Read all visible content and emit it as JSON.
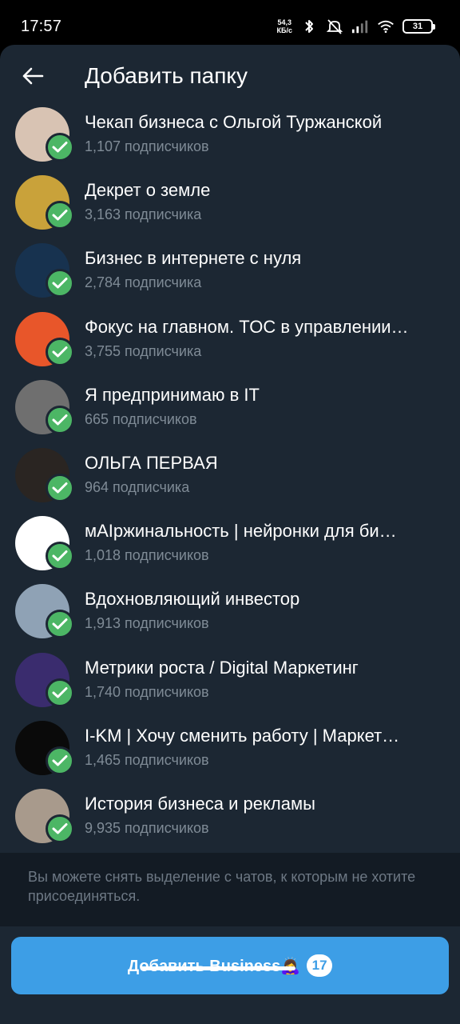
{
  "status_bar": {
    "time": "17:57",
    "net_speed_value": "54,3",
    "net_speed_unit": "КБ/с",
    "battery": "31",
    "icons": [
      "bluetooth-icon",
      "mute-icon",
      "signal-icon",
      "wifi-icon",
      "battery-icon"
    ]
  },
  "header": {
    "title": "Добавить папку",
    "back_icon": "arrow-left-icon"
  },
  "channels": [
    {
      "name": "Чекап бизнеса с Ольгой Туржанской",
      "subscribers": "1,107 подписчиков",
      "avatar_color": "#d8c3b3",
      "selected": true
    },
    {
      "name": "Декрет о земле",
      "subscribers": "3,163 подписчика",
      "avatar_color": "#c9a23a",
      "selected": true
    },
    {
      "name": "Бизнес в интернете с нуля",
      "subscribers": "2,784 подписчика",
      "avatar_color": "#17324f",
      "selected": true
    },
    {
      "name": "Фокус на главном. TOC в управлении…",
      "subscribers": "3,755 подписчика",
      "avatar_color": "#e8562a",
      "selected": true
    },
    {
      "name": "Я предпринимаю в IT",
      "subscribers": "665 подписчиков",
      "avatar_color": "#6f6f6f",
      "selected": true
    },
    {
      "name": "ОЛЬГА ПЕРВАЯ",
      "subscribers": "964 подписчика",
      "avatar_color": "#2a2522",
      "selected": true
    },
    {
      "name": "мAIржинальность | нейронки для би…",
      "subscribers": "1,018 подписчиков",
      "avatar_color": "#ffffff",
      "selected": true
    },
    {
      "name": "Вдохновляющий инвестор",
      "subscribers": "1,913 подписчиков",
      "avatar_color": "#8fa2b5",
      "selected": true
    },
    {
      "name": "Метрики роста / Digital Маркетинг",
      "subscribers": "1,740 подписчиков",
      "avatar_color": "#3a2c6e",
      "selected": true
    },
    {
      "name": "I-KM | Хочу сменить работу | Маркет…",
      "subscribers": "1,465 подписчиков",
      "avatar_color": "#0a0a0a",
      "selected": true
    },
    {
      "name": "История бизнеса и рекламы",
      "subscribers": "9,935 подписчиков",
      "avatar_color": "#a89a8c",
      "selected": true
    }
  ],
  "hint": "Вы можете снять выделение с чатов, к которым не хотите присоединяться.",
  "add_button": {
    "label": "Добавить Business🙇‍♀️",
    "count": "17"
  },
  "colors": {
    "accent": "#3d9ee6",
    "check": "#4cb665",
    "sheet_bg": "#1c2733",
    "secondary_text": "#7f8b96"
  }
}
